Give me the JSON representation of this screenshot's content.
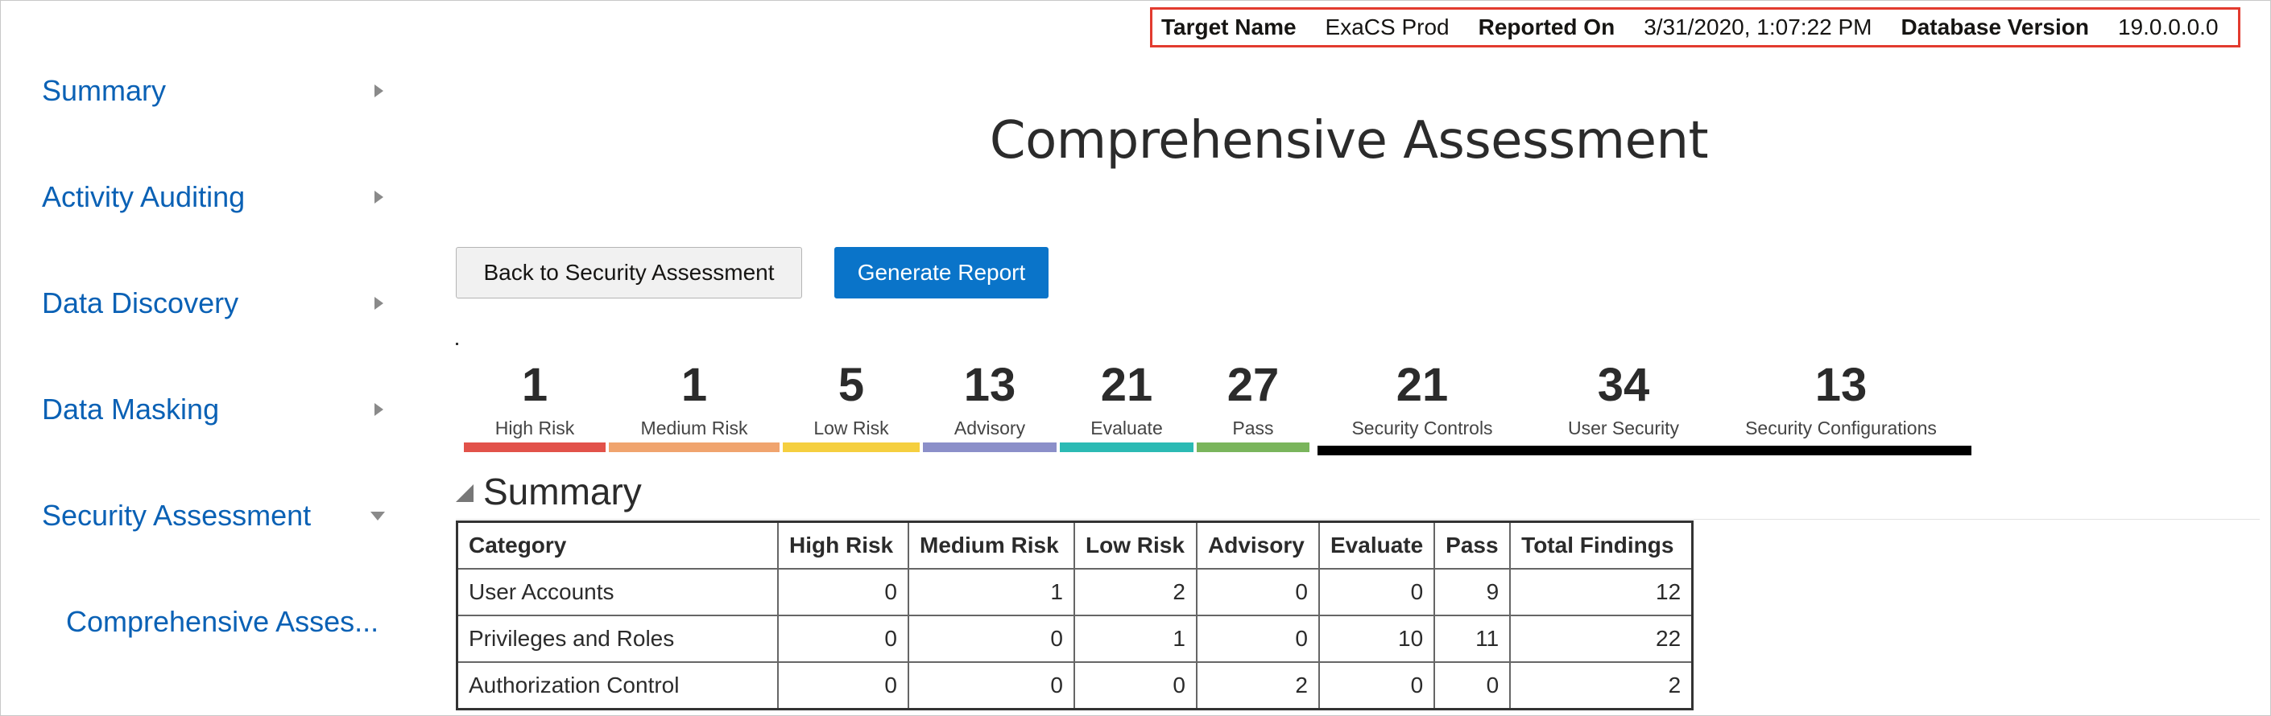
{
  "sidebar": {
    "items": [
      {
        "label": "Summary",
        "expanded": false
      },
      {
        "label": "Activity Auditing",
        "expanded": false
      },
      {
        "label": "Data Discovery",
        "expanded": false
      },
      {
        "label": "Data Masking",
        "expanded": false
      },
      {
        "label": "Security Assessment",
        "expanded": true
      }
    ],
    "subitems": [
      {
        "label": "Comprehensive Asses..."
      }
    ]
  },
  "header": {
    "target_name_label": "Target Name",
    "target_name_value": "ExaCS Prod",
    "reported_on_label": "Reported On",
    "reported_on_value": "3/31/2020, 1:07:22 PM",
    "db_version_label": "Database Version",
    "db_version_value": "19.0.0.0.0"
  },
  "page_title": "Comprehensive Assessment",
  "buttons": {
    "back": "Back to Security Assessment",
    "generate": "Generate Report"
  },
  "stats": [
    {
      "value": "1",
      "label": "High Risk",
      "color": "#e2524a"
    },
    {
      "value": "1",
      "label": "Medium Risk",
      "color": "#f0a46e"
    },
    {
      "value": "5",
      "label": "Low Risk",
      "color": "#f5cf3f"
    },
    {
      "value": "13",
      "label": "Advisory",
      "color": "#8b8fc9"
    },
    {
      "value": "21",
      "label": "Evaluate",
      "color": "#2bbab4"
    },
    {
      "value": "27",
      "label": "Pass",
      "color": "#7ab55c"
    },
    {
      "value": "21",
      "label": "Security Controls",
      "color": "#000000"
    },
    {
      "value": "34",
      "label": "User Security",
      "color": "#000000"
    },
    {
      "value": "13",
      "label": "Security Configurations",
      "color": "#000000"
    }
  ],
  "summary": {
    "title": "Summary",
    "columns": [
      "Category",
      "High Risk",
      "Medium Risk",
      "Low Risk",
      "Advisory",
      "Evaluate",
      "Pass",
      "Total Findings"
    ],
    "rows": [
      [
        "User Accounts",
        "0",
        "1",
        "2",
        "0",
        "0",
        "9",
        "12"
      ],
      [
        "Privileges and Roles",
        "0",
        "0",
        "1",
        "0",
        "10",
        "11",
        "22"
      ],
      [
        "Authorization Control",
        "0",
        "0",
        "0",
        "2",
        "0",
        "0",
        "2"
      ]
    ]
  }
}
